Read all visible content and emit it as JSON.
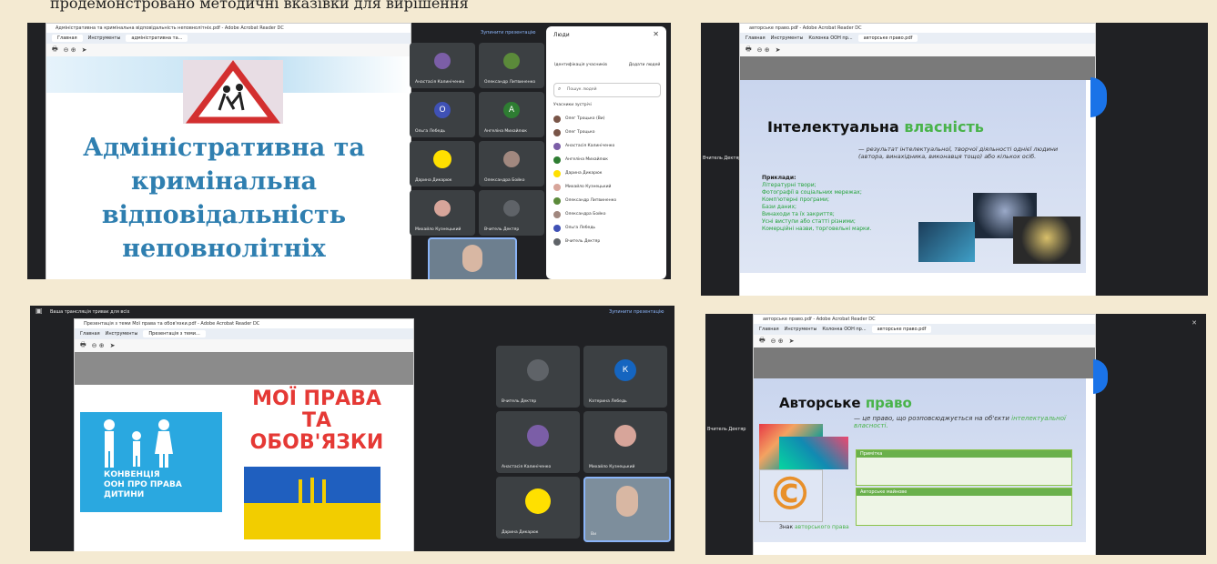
{
  "caption_fragment": "продемонстровано методичні вказівки для вирішення",
  "shot1": {
    "window_title": "Адміністративна та кримінальна відповідальність неповнолітніх.pdf - Adobe Acrobat Reader DC",
    "tabs": [
      "Главная",
      "Инструменты",
      "адміністративна та..."
    ],
    "slide_title_lines": [
      "Адміністративна та",
      "кримінальна",
      "відповідальність",
      "неповнолітніх"
    ],
    "meet_link": "Зупинити презентацію",
    "participants_tiles": [
      {
        "name": "Анастасія Калиніченко",
        "initial": "",
        "color": "#7b5ea7"
      },
      {
        "name": "Олександр Литвиненко",
        "initial": "",
        "color": "#5b8a3a"
      },
      {
        "name": "Ольга Лебедь",
        "initial": "О",
        "color": "#3f51b5"
      },
      {
        "name": "Ангеліна Михайлюк",
        "initial": "А",
        "color": "#2e7d32"
      },
      {
        "name": "Дарина Дикарюк",
        "initial": "",
        "color": "#ffe000"
      },
      {
        "name": "Олександра Бойко",
        "initial": "",
        "color": "#a1887f"
      },
      {
        "name": "Михайло Кузнецький",
        "initial": "",
        "color": "#d7a59a"
      },
      {
        "name": "Вчитель Дектяр",
        "initial": "",
        "color": "#5f6368"
      }
    ],
    "panel": {
      "title": "Люди",
      "action1": "Ідентифікація учасників",
      "action2": "Додати людей",
      "search_placeholder": "Пошук людей",
      "section": "Учасники зустрічі",
      "people": [
        {
          "name": "Олег Троцько (Ви)",
          "color": "#795548"
        },
        {
          "name": "Олег Троцько",
          "color": "#795548"
        },
        {
          "name": "Анастасія Калиніченко",
          "color": "#7b5ea7"
        },
        {
          "name": "Ангеліна Михайлюк",
          "color": "#2e7d32"
        },
        {
          "name": "Дарина Дикарюк",
          "color": "#ffe000"
        },
        {
          "name": "Михайло Кузнецький",
          "color": "#d7a59a"
        },
        {
          "name": "Олександр Литвиненко",
          "color": "#5b8a3a"
        },
        {
          "name": "Олександра Бойко",
          "color": "#a1887f"
        },
        {
          "name": "Ольга Лебедь",
          "color": "#3f51b5"
        },
        {
          "name": "Вчитель Дектяр",
          "color": "#5f6368"
        }
      ]
    }
  },
  "shot2": {
    "window_title": "авторське право.pdf - Adobe Acrobat Reader DC",
    "tabs": [
      "Главная",
      "Инструменты",
      "Колонка ООН пр...",
      "авторське право.pdf"
    ],
    "heading_black": "Інтелектуальна",
    "heading_green": "власність",
    "definition": "— результат інтелектуальної, творчої діяльності однієї людини (автора, винахідника, виконавця тощо) або кількох осіб.",
    "examples_label": "Приклади:",
    "examples": [
      "Літературні твори;",
      "Фотографії в соціальних мережах;",
      "Комп'ютерні програми;",
      "Бази даних;",
      "Винаходи та їх закриття;",
      "Усні виступи або статті різними;",
      "Комерційні назви, торговельні марки."
    ],
    "host_name": "Вчитель Дектяр"
  },
  "shot3": {
    "bar_title": "Ваша трансляція триває для всіх",
    "bar_link": "Зупинити презентацію",
    "window_title": "Презентація з теми Мої права та обов'язки.pdf - Adobe Acrobat Reader DC",
    "tabs": [
      "Главная",
      "Инструменты",
      "Презентація з теми..."
    ],
    "slide_title_lines": [
      "МОЇ ПРАВА",
      "ТА",
      "ОБОВ'ЯЗКИ"
    ],
    "poster_text": [
      "КОНВЕНЦІЯ",
      "ООН ПРО ПРАВА",
      "ДИТИНИ"
    ],
    "tiles": [
      {
        "name": "Вчитель Дектяр",
        "initial": "",
        "color": "#5f6368"
      },
      {
        "name": "Катерина Лебедь",
        "initial": "К",
        "color": "#1565c0"
      },
      {
        "name": "Анастасія Калиніченко",
        "initial": "",
        "color": "#7b5ea7"
      },
      {
        "name": "Михайло Кузнецький",
        "initial": "",
        "color": "#d7a59a"
      },
      {
        "name": "Дарина Дикарюк",
        "initial": "",
        "color": "#ffe000"
      },
      {
        "name": "Ви",
        "initial": "",
        "color": "#b0bec5"
      }
    ]
  },
  "shot4": {
    "window_title": "авторське право.pdf - Adobe Acrobat Reader DC",
    "tabs": [
      "Главная",
      "Инструменты",
      "Колонка ООН пр...",
      "авторське право.pdf"
    ],
    "heading_black": "Авторське",
    "heading_green": "право",
    "definition": "— це право, що розповсюджується на об'єкти",
    "definition_green": "інтелектуальної власності.",
    "box1_title": "Примітка",
    "box2_title": "Авторське майнове",
    "sign_label": "Знак",
    "sign_label_green": "авторського права",
    "copyright_symbol": "©",
    "host_name": "Вчитель Дектяр"
  }
}
